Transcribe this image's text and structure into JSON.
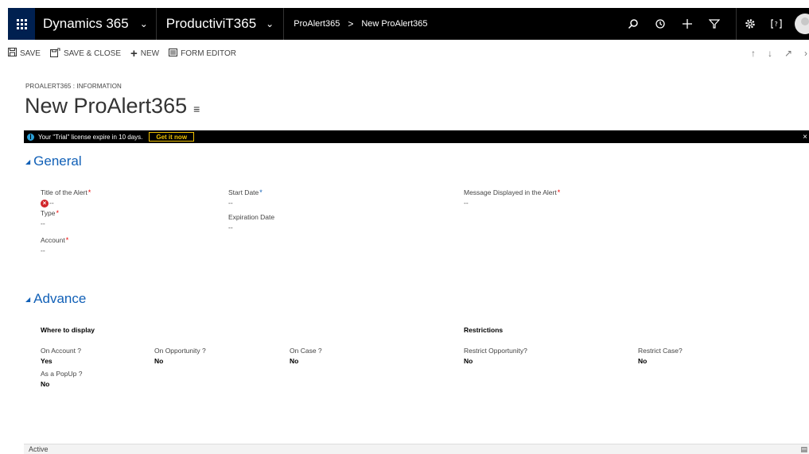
{
  "nav": {
    "brand": "Dynamics 365",
    "app": "ProductiviT365",
    "breadcrumb": [
      "ProAlert365",
      "New ProAlert365"
    ],
    "icons": [
      "search-icon",
      "history-icon",
      "plus-icon",
      "filter-icon",
      "gear-icon",
      "help-icon",
      "avatar"
    ]
  },
  "commands": {
    "save": "SAVE",
    "save_close": "SAVE & CLOSE",
    "new": "NEW",
    "form_editor": "FORM EDITOR"
  },
  "header": {
    "entity_label": "PROALERT365 : INFORMATION",
    "title": "New ProAlert365"
  },
  "banner": {
    "message": "Your \"Trial\" license expire in 10 days.",
    "button": "Get it now",
    "close": "×"
  },
  "general": {
    "title": "General",
    "fields": {
      "title_alert": {
        "label": "Title of the Alert",
        "value": "--"
      },
      "type": {
        "label": "Type",
        "value": "--"
      },
      "account": {
        "label": "Account",
        "value": "--"
      },
      "start_date": {
        "label": "Start Date",
        "value": "--"
      },
      "expiration_date": {
        "label": "Expiration Date",
        "value": "--"
      },
      "message": {
        "label": "Message Displayed in the Alert",
        "value": "--"
      }
    }
  },
  "advance": {
    "title": "Advance",
    "where_to_display": "Where to display",
    "restrictions": "Restrictions",
    "fields": {
      "on_account": {
        "label": "On Account ?",
        "value": "Yes"
      },
      "on_opportunity": {
        "label": "On Opportunity ?",
        "value": "No"
      },
      "on_case": {
        "label": "On Case ?",
        "value": "No"
      },
      "popup": {
        "label": "As a PopUp ?",
        "value": "No"
      },
      "restrict_opportunity": {
        "label": "Restrict Opportunity?",
        "value": "No"
      },
      "restrict_case": {
        "label": "Restrict Case?",
        "value": "No"
      }
    }
  },
  "footer": {
    "status": "Active"
  },
  "colors": {
    "nav_bg": "#000000",
    "waffle_bg": "#002050",
    "section_heading": "#1160b7",
    "required": "#e00000",
    "banner_button": "#f0c000"
  }
}
